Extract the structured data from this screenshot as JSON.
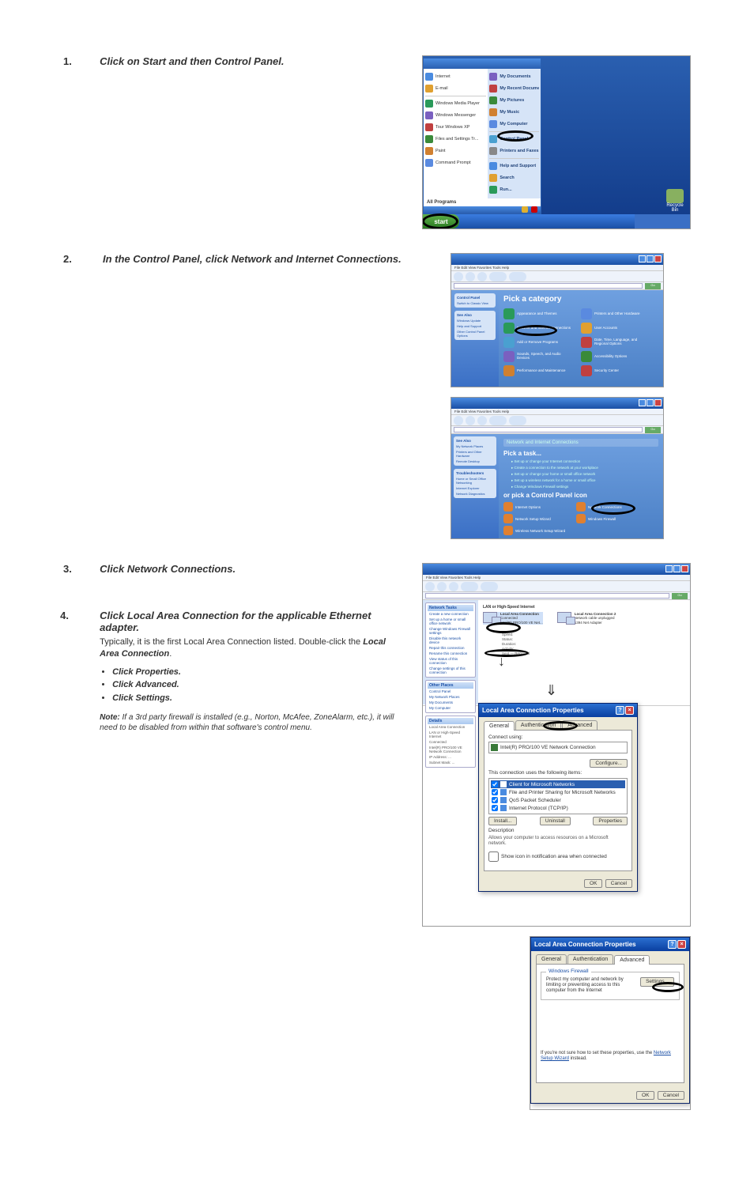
{
  "steps": [
    {
      "num": "1.",
      "title": "Click on Start and then Control Panel.",
      "body": ""
    },
    {
      "num": "2.",
      "title": "In the Control Panel, click Network and Internet Connections.",
      "body": ""
    },
    {
      "num": "3.",
      "title": "Click Network Connections.",
      "body": ""
    },
    {
      "num": "4.",
      "title": "Click Local Area Connection for the applicable Ethernet adapter.",
      "body_pre": "Typically, it is the first Local Area Connection listed. Double-click the ",
      "body_link": "Local Area Connection",
      "body_list": [
        "Click Properties.",
        "Click Advanced.",
        "Click Settings."
      ]
    }
  ],
  "note": {
    "label": "Note:",
    "text": "If a 3rd party firewall is installed (e.g., Norton, McAfee, ZoneAlarm, etc.), it will need to be disabled from within that software's control menu."
  },
  "shot1": {
    "quicklaunch_colors": [
      "#d08030",
      "#4a8be0",
      "#2a7a22"
    ],
    "left_items": [
      "Internet",
      "E-mail",
      "Windows Media Player",
      "Windows Messenger",
      "Tour Windows XP",
      "Files and Settings Tr...",
      "Paint",
      "Command Prompt"
    ],
    "right_items": [
      "My Documents",
      "My Recent Documents",
      "My Pictures",
      "My Music",
      "My Computer",
      "Control Panel",
      "Printers and Faxes",
      "Help and Support",
      "Search",
      "Run..."
    ],
    "all_programs": "All Programs",
    "recycle": "Recycle Bin",
    "start": "start"
  },
  "shot2": {
    "menubar": "File  Edit  View  Favorites  Tools  Help",
    "go": "Go",
    "side_header": "Control Panel",
    "side_switch": "Switch to Classic View",
    "see_also": "See Also",
    "see_items": [
      "Windows Update",
      "Help and Support",
      "Other Control Panel Options"
    ],
    "title": "Pick a category",
    "cats": [
      {
        "tx": "Appearance and Themes",
        "c": "#2a9a5a"
      },
      {
        "tx": "Printers and Other Hardware",
        "c": "#5a8ae0"
      },
      {
        "tx": "Network and Internet Connections",
        "c": "#2a9a5a"
      },
      {
        "tx": "User Accounts",
        "c": "#e0a030"
      },
      {
        "tx": "Add or Remove Programs",
        "c": "#4aa0d0"
      },
      {
        "tx": "Date, Time, Language, and Regional Options",
        "c": "#c04040"
      },
      {
        "tx": "Sounds, Speech, and Audio Devices",
        "c": "#7a60c0"
      },
      {
        "tx": "Accessibility Options",
        "c": "#3a8a3a"
      },
      {
        "tx": "Performance and Maintenance",
        "c": "#d08030"
      },
      {
        "tx": "Security Center",
        "c": "#c04040"
      }
    ]
  },
  "shot3": {
    "side_header": "See Also",
    "side_items": [
      "My Network Places",
      "Printers and Other Hardware",
      "Remote Desktop"
    ],
    "trouble_h": "Troubleshooters",
    "trouble_items": [
      "Home or Small Office Networking",
      "Internet Explorer",
      "Network Diagnostics"
    ],
    "banner": "Network and Internet Connections",
    "task_h": "Pick a task...",
    "tasks": [
      "Set up or change your Internet connection",
      "Create a connection to the network at your workplace",
      "Set up or change your home or small office network",
      "Set up a wireless network for a home or small office",
      "Change Windows Firewall settings"
    ],
    "icon_h": "or pick a Control Panel icon",
    "icons": [
      "Internet Options",
      "Network Connections",
      "Network Setup Wizard",
      "Windows Firewall",
      "Wireless Network Setup Wizard"
    ]
  },
  "shot4": {
    "side_boxes": [
      {
        "h": "Network Tasks",
        "items": [
          "Create a new connection",
          "Set up a home or small office network",
          "Change Windows Firewall settings",
          "Disable this network device",
          "Repair this connection",
          "Rename this connection",
          "View status of this connection",
          "Change settings of this connection"
        ]
      },
      {
        "h": "Other Places",
        "items": [
          "Control Panel",
          "My Network Places",
          "My Documents",
          "My Computer"
        ]
      },
      {
        "h": "Details",
        "items": []
      }
    ],
    "details": [
      "Local Area Connection",
      "LAN or High-Speed Internet",
      "Connected",
      "Intel(R) PRO/100 VE Network Connection",
      "IP Address: ...",
      "Subnet Mask: ..."
    ],
    "group": "LAN or High-Speed Internet",
    "conns": [
      {
        "name": "Local Area Connection",
        "sub": "Connected",
        "dev": "Intel(R) PRO/100 VE Net..."
      },
      {
        "name": "Local Area Connection 2",
        "sub": "Network cable unplugged",
        "dev": "1394 Net Adapter"
      }
    ],
    "status": [
      "Speed:",
      "Status:",
      "Duration:",
      "Activity:",
      "Sent — Received"
    ]
  },
  "dlg1": {
    "title": "Local Area Connection Properties",
    "tabs": [
      "General",
      "Authentication",
      "Advanced"
    ],
    "connect_using": "Connect using:",
    "adapter": "Intel(R) PRO/100 VE Network Connection",
    "configure": "Configure...",
    "items_label": "This connection uses the following items:",
    "items": [
      {
        "tx": "Client for Microsoft Networks",
        "sel": true
      },
      {
        "tx": "File and Printer Sharing for Microsoft Networks",
        "sel": false
      },
      {
        "tx": "QoS Packet Scheduler",
        "sel": false
      },
      {
        "tx": "Internet Protocol (TCP/IP)",
        "sel": false
      }
    ],
    "install": "Install...",
    "uninstall": "Uninstall",
    "properties": "Properties",
    "desc_h": "Description",
    "desc": "Allows your computer to access resources on a Microsoft network.",
    "show_icon": "Show icon in notification area when connected",
    "ok": "OK",
    "cancel": "Cancel"
  },
  "dlg2": {
    "title": "Local Area Connection Properties",
    "tabs": [
      "General",
      "Authentication",
      "Advanced"
    ],
    "group_title": "Windows Firewall",
    "group_body": "Protect my computer and network by limiting or preventing access to this computer from the Internet",
    "settings": "Settings...",
    "footer_pre": "If you're not sure how to set these properties, use the ",
    "footer_link": "Network Setup Wizard",
    "footer_post": " instead.",
    "ok": "OK",
    "cancel": "Cancel"
  }
}
